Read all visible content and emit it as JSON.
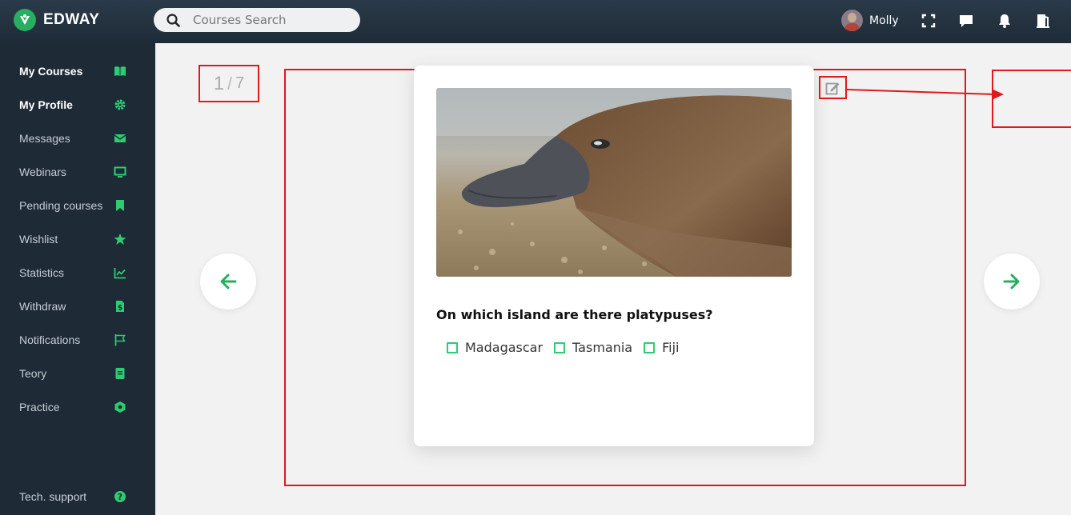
{
  "app": {
    "name": "EDWAY"
  },
  "search": {
    "placeholder": "Courses Search"
  },
  "user": {
    "name": "Molly"
  },
  "sidebar": {
    "items": [
      {
        "label": "My Courses",
        "icon": "book-icon"
      },
      {
        "label": "My Profile",
        "icon": "gear-icon"
      },
      {
        "label": "Messages",
        "icon": "envelope-icon"
      },
      {
        "label": "Webinars",
        "icon": "monitor-icon"
      },
      {
        "label": "Pending courses",
        "icon": "bookmark-icon"
      },
      {
        "label": "Wishlist",
        "icon": "star-icon"
      },
      {
        "label": "Statistics",
        "icon": "chart-icon"
      },
      {
        "label": "Withdraw",
        "icon": "dollar-file-icon"
      },
      {
        "label": "Notifications",
        "icon": "flag-icon"
      },
      {
        "label": "Teory",
        "icon": "document-icon"
      },
      {
        "label": "Practice",
        "icon": "cube-icon"
      }
    ],
    "support": {
      "label": "Tech. support",
      "icon": "question-icon"
    }
  },
  "quiz": {
    "current": "1",
    "separator": "/",
    "total": "7",
    "question": "On which island are there platypuses?",
    "options": [
      "Madagascar",
      "Tasmania",
      "Fiji"
    ]
  },
  "colors": {
    "accent": "#2ecc71",
    "sidebar_bg": "#1e2b37",
    "annotation": "#e0191d"
  }
}
